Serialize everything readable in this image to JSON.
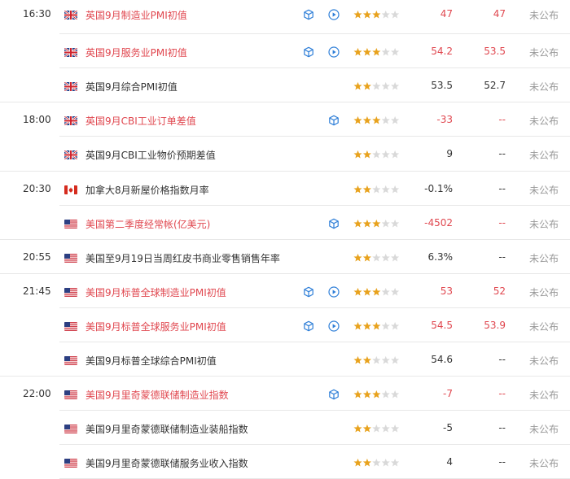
{
  "rows": [
    {
      "time": "16:30",
      "flag": "uk",
      "title": "英国9月制造业PMI初值",
      "red": true,
      "icons": [
        "cube",
        "play"
      ],
      "stars": 3,
      "prev": "47",
      "cons": "47",
      "act": "未公布",
      "prev_red": true,
      "cons_red": true
    },
    {
      "time": "",
      "flag": "uk",
      "title": "英国9月服务业PMI初值",
      "red": true,
      "icons": [
        "cube",
        "play"
      ],
      "stars": 3,
      "prev": "54.2",
      "cons": "53.5",
      "act": "未公布",
      "prev_red": true,
      "cons_red": true
    },
    {
      "time": "",
      "flag": "uk",
      "title": "英国9月综合PMI初值",
      "red": false,
      "icons": [],
      "stars": 2,
      "prev": "53.5",
      "cons": "52.7",
      "act": "未公布",
      "prev_red": false,
      "cons_red": false
    },
    {
      "time": "18:00",
      "flag": "uk",
      "title": "英国9月CBI工业订单差值",
      "red": true,
      "icons": [
        "cube"
      ],
      "stars": 3,
      "prev": "-33",
      "cons": "--",
      "act": "未公布",
      "prev_red": true,
      "cons_red": true
    },
    {
      "time": "",
      "flag": "uk",
      "title": "英国9月CBI工业物价预期差值",
      "red": false,
      "icons": [],
      "stars": 2,
      "prev": "9",
      "cons": "--",
      "act": "未公布",
      "prev_red": false,
      "cons_red": false
    },
    {
      "time": "20:30",
      "flag": "ca",
      "title": "加拿大8月新屋价格指数月率",
      "red": false,
      "icons": [],
      "stars": 2,
      "prev": "-0.1%",
      "cons": "--",
      "act": "未公布",
      "prev_red": false,
      "cons_red": false
    },
    {
      "time": "",
      "flag": "us",
      "title": "美国第二季度经常帐(亿美元)",
      "red": true,
      "icons": [
        "cube"
      ],
      "stars": 3,
      "prev": "-4502",
      "cons": "--",
      "act": "未公布",
      "prev_red": true,
      "cons_red": true
    },
    {
      "time": "20:55",
      "flag": "us",
      "title": "美国至9月19日当周红皮书商业零售销售年率",
      "red": false,
      "icons": [],
      "stars": 2,
      "prev": "6.3%",
      "cons": "--",
      "act": "未公布",
      "prev_red": false,
      "cons_red": false
    },
    {
      "time": "21:45",
      "flag": "us",
      "title": "美国9月标普全球制造业PMI初值",
      "red": true,
      "icons": [
        "cube",
        "play"
      ],
      "stars": 3,
      "prev": "53",
      "cons": "52",
      "act": "未公布",
      "prev_red": true,
      "cons_red": true
    },
    {
      "time": "",
      "flag": "us",
      "title": "美国9月标普全球服务业PMI初值",
      "red": true,
      "icons": [
        "cube",
        "play"
      ],
      "stars": 3,
      "prev": "54.5",
      "cons": "53.9",
      "act": "未公布",
      "prev_red": true,
      "cons_red": true
    },
    {
      "time": "",
      "flag": "us",
      "title": "美国9月标普全球综合PMI初值",
      "red": false,
      "icons": [],
      "stars": 2,
      "prev": "54.6",
      "cons": "--",
      "act": "未公布",
      "prev_red": false,
      "cons_red": false
    },
    {
      "time": "22:00",
      "flag": "us",
      "title": "美国9月里奇蒙德联储制造业指数",
      "red": true,
      "icons": [
        "cube"
      ],
      "stars": 3,
      "prev": "-7",
      "cons": "--",
      "act": "未公布",
      "prev_red": true,
      "cons_red": true
    },
    {
      "time": "",
      "flag": "us",
      "title": "美国9月里奇蒙德联储制造业装船指数",
      "red": false,
      "icons": [],
      "stars": 2,
      "prev": "-5",
      "cons": "--",
      "act": "未公布",
      "prev_red": false,
      "cons_red": false
    },
    {
      "time": "",
      "flag": "us",
      "title": "美国9月里奇蒙德联储服务业收入指数",
      "red": false,
      "icons": [],
      "stars": 2,
      "prev": "4",
      "cons": "--",
      "act": "未公布",
      "prev_red": false,
      "cons_red": false
    }
  ],
  "colors": {
    "red": "#e0474f",
    "star_on": "#e8a21d",
    "star_off": "#d9d9d9",
    "icon_blue": "#2f7fd8"
  }
}
